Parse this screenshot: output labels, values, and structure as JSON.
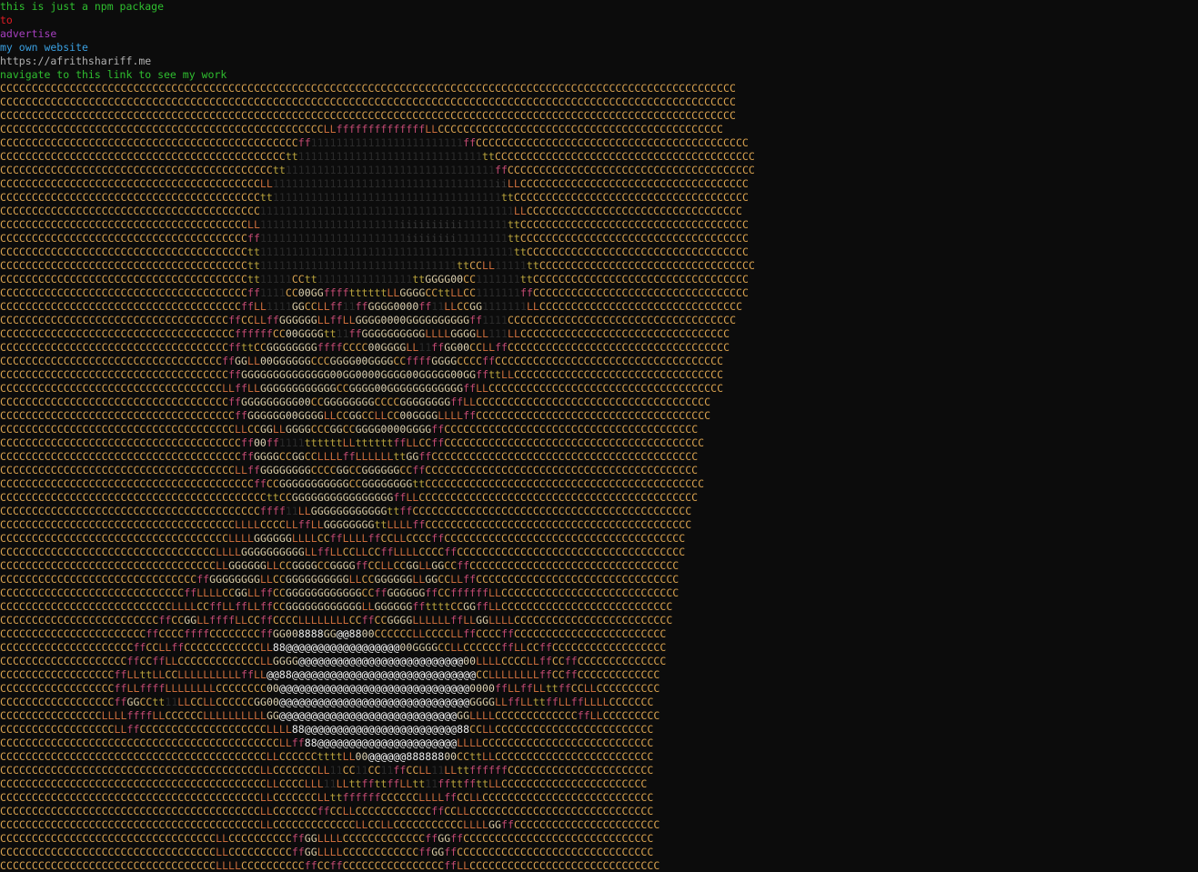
{
  "messages": [
    {
      "text": "this is just a npm package",
      "color": "#2fbf2f"
    },
    {
      "text": "to",
      "color": "#e01b24"
    },
    {
      "text": "advertise",
      "color": "#a63fbf"
    },
    {
      "text": "my own website",
      "color": "#3a9fe0"
    },
    {
      "text": "https://afrithshariff.me",
      "color": "#b0b0b0"
    },
    {
      "text": "navigate to this link to see my work",
      "color": "#2fbf2f"
    }
  ],
  "ascii_art": {
    "background_char": "C",
    "rows": [
      "CCCCCCCCCCCCCCCCCCCCCCCCCCCCCCCCCCCCCCCCCCCCCCCCCCCCCCCCCCCCCCCCCCCCCCCCCCCCCCCCCCCCCCCCCCCCCCCCCCCCCCCCCCCCCCCCCCCC",
      "CCCCCCCCCCCCCCCCCCCCCCCCCCCCCCCCCCCCCCCCCCCCCCCCCCCCCCCCCCCCCCCCCCCCCCCCCCCCCCCCCCCCCCCCCCCCCCCCCCCCCCCCCCCCCCCCCCCC",
      "CCCCCCCCCCCCCCCCCCCCCCCCCCCCCCCCCCCCCCCCCCCCCCCCCCCCCCCCCCCCCCCCCCCCCCCCCCCCCCCCCCCCCCCCCCCCCCCCCCCCCCCCCCCCCCCCCCCC",
      "CCCCCCCCCCCCCCCCCCCCCCCCCCCCCCCCCCCCCCCCCCCCCCCCCCCLLffffffffffffffLLCCCCCCCCCCCCCCCCCCCCCCCCCCCCCCCCCCCCCCCCCCCCC",
      "CCCCCCCCCCCCCCCCCCCCCCCCCCCCCCCCCCCCCCCCCCCCCCCff111111111111111111111111ffCCCCCCCCCCCCCCCCCCCCCCCCCCCCCCCCCCCCCCCCCCC",
      "CCCCCCCCCCCCCCCCCCCCCCCCCCCCCCCCCCCCCCCCCCCCCtt11111111111111111111111111111ttCCCCCCCCCCCCCCCCCCCCCCCCCCCCCCCCCCCCCCCCC",
      "CCCCCCCCCCCCCCCCCCCCCCCCCCCCCCCCCCCCCCCCCCCtt111111111111111111111111111111111ffCCCCCCCCCCCCCCCCCCCCCCCCCCCCCCCCCCCCCCC",
      "CCCCCCCCCCCCCCCCCCCCCCCCCCCCCCCCCCCCCCCCCLL11111111111111111111111111111111111iiLLCCCCCCCCCCCCCCCCCCCCCCCCCCCCCCCCCCCC",
      "CCCCCCCCCCCCCCCCCCCCCCCCCCCCCCCCCCCCCCCCCtt111111111111111111111111111111111111ttCCCCCCCCCCCCCCCCCCCCCCCCCCCCCCCCCCCCC",
      "CCCCCCCCCCCCCCCCCCCCCCCCCCCCCCCCCCCCCCCCC1111111111111111111111111111111111111111LLCCCCCCCCCCCCCCCCCCCCCCCCCCCCCCCCCC",
      "CCCCCCCCCCCCCCCCCCCCCCCCCCCCCCCCCCCCCCCLL1111111111111111111111iiiiiiiiii1111111ttCCCCCCCCCCCCCCCCCCCCCCCCCCCCCCCCCCCC",
      "CCCCCCCCCCCCCCCCCCCCCCCCCCCCCCCCCCCCCCCff11111111111111111111111iiiiiiii11111111ttCCCCCCCCCCCCCCCCCCCCCCCCCCCCCCCCCCCC",
      "CCCCCCCCCCCCCCCCCCCCCCCCCCCCCCCCCCCCCCCtt1111111111111111111111111111111111111111ttCCCCCCCCCCCCCCCCCCCCCCCCCCCCCCCCCCC",
      "CCCCCCCCCCCCCCCCCCCCCCCCCCCCCCCCCCCCCCCtt1111111111111111111111111111111ttCCLL11111ttCCCCCCCCCCCCCCCCCCCCCCCCCCCCCCCCCC",
      "CCCCCCCCCCCCCCCCCCCCCCCCCCCCCCCCCCCCCCCtt11111CCtt111111111111111ttGGGG00CC1111111ttCCCCCCCCCCCCCCCCCCCCCCCCCCCCCCCCCC",
      "CCCCCCCCCCCCCCCCCCCCCCCCCCCCCCCCCCCCCCCff1111CC00GGffffttttttLLGGGGCCttLLCC1111111ffCCCCCCCCCCCCCCCCCCCCCCCCCCCCCCCCCC",
      "CCCCCCCCCCCCCCCCCCCCCCCCCCCCCCCCCCCCCCffLL1111GGCCLLff11ffGGGG0000ff11LLCCGG1111111LLCCCCCCCCCCCCCCCCCCCCCCCCCCCCCCCC",
      "CCCCCCCCCCCCCCCCCCCCCCCCCCCCCCCCCCCCffCCLLffGGGGGGLLffLLGGGG0000GGGGGGGGGGff1111CCCCCCCCCCCCCCCCCCCCCCCCCCCCCCCCCCCC",
      "CCCCCCCCCCCCCCCCCCCCCCCCCCCCCCCCCCCCCffffffCC00GGGGtt11ffGGGGGGGGGGLLLLGGGGLL111LLCCCCCCCCCCCCCCCCCCCCCCCCCCCCCCCCC",
      "CCCCCCCCCCCCCCCCCCCCCCCCCCCCCCCCCCCCffttCCGGGGGGGGffffCCCC00GGGGLL11ffGG00CCLLffCCCCCCCCCCCCCCCCCCCCCCCCCCCCCCCCCCC",
      "CCCCCCCCCCCCCCCCCCCCCCCCCCCCCCCCCCCffGGLL00GGGGGGCCCGGGG00GGGGCCffffGGGGCCCCffCCCCCCCCCCCCCCCCCCCCCCCCCCCCCCCCCCCC",
      "CCCCCCCCCCCCCCCCCCCCCCCCCCCCCCCCCCCCffGGGGGGGGGGGGGG00GG0000GGGG00GGGGG00GGffttLLCCCCCCCCCCCCCCCCCCCCCCCCCCCCCCCCC",
      "CCCCCCCCCCCCCCCCCCCCCCCCCCCCCCCCCCCLLffLLGGGGGGGGGGGGCCGGGG00GGGGGGGGGGGGffLLCCCCCCCCCCCCCCCCCCCCCCCCCCCCCCCCCCCCC",
      "CCCCCCCCCCCCCCCCCCCCCCCCCCCCCCCCCCCCffGGGGGGGGG00CCGGGGGGGGCCCCGGGGGGGGffLLCCCCCCCCCCCCCCCCCCCCCCCCCCCCCCCCCCCCC",
      "CCCCCCCCCCCCCCCCCCCCCCCCCCCCCCCCCCCCCffGGGGGG00GGGGLLCCGGCCLLCC00GGGGLLLLffCCCCCCCCCCCCCCCCCCCCCCCCCCCCCCCCCCCCC",
      "CCCCCCCCCCCCCCCCCCCCCCCCCCCCCCCCCCCCCLLCCGGLLGGGGCCCGGCCGGGG0000GGGGffCCCCCCCCCCCCCCCCCCCCCCCCCCCCCCCCCCCCCCCC",
      "CCCCCCCCCCCCCCCCCCCCCCCCCCCCCCCCCCCCCCff00ff1111ttttttLLttttttffLLCCffCCCCCCCCCCCCCCCCCCCCCCCCCCCCCCCCCCCCCCCCC",
      "CCCCCCCCCCCCCCCCCCCCCCCCCCCCCCCCCCCCCCffGGGGCCGGCCLLLLffLLLLLLttGGffCCCCCCCCCCCCCCCCCCCCCCCCCCCCCCCCCCCCCCCCCC",
      "CCCCCCCCCCCCCCCCCCCCCCCCCCCCCCCCCCCCCLLffGGGGGGGGCCCCGGCCGGGGGGCCffCCCCCCCCCCCCCCCCCCCCCCCCCCCCCCCCCCCCCCCCCCC",
      "CCCCCCCCCCCCCCCCCCCCCCCCCCCCCCCCCCCCCCCCffCCGGGGGGGGGGGCCGGGGGGGGttCCCCCCCCCCCCCCCCCCCCCCCCCCCCCCCCCCCCCCCCCCCC",
      "CCCCCCCCCCCCCCCCCCCCCCCCCCCCCCCCCCCCCCCCCCttCCGGGGGGGGGGGGGGGGffLLCCCCCCCCCCCCCCCCCCCCCCCCCCCCCCCCCCCCCCCCCCCC",
      "CCCCCCCCCCCCCCCCCCCCCCCCCCCCCCCCCCCCCCCCCffff11LLGGGGGGGGGGGGttffCCCCCCCCCCCCCCCCCCCCCCCCCCCCCCCCCCCCCCCCCCCC",
      "CCCCCCCCCCCCCCCCCCCCCCCCCCCCCCCCCCCCCLLLLCCCCLLffLLGGGGGGGGttLLLLffCCCCCCCCCCCCCCCCCCCCCCCCCCCCCCCCCCCCCCCCCC",
      "CCCCCCCCCCCCCCCCCCCCCCCCCCCCCCCCCCCCLLLLGGGGGGLLLLCCffLLLLffCCLLCCCCffCCCCCCCCCCCCCCCCCCCCCCCCCCCCCCCCCCCCCC",
      "CCCCCCCCCCCCCCCCCCCCCCCCCCCCCCCCCCLLLLGGGGGGGGGGLLffLLCCLLCCffLLLLCCCCffCCCCCCCCCCCCCCCCCCCCCCCCCCCCCCCCCCCC",
      "CCCCCCCCCCCCCCCCCCCCCCCCCCCCCCCCCCLLGGGGGGLLCCGGGGCCGGGGffCCLLCCGGLLGGCCffCCCCCCCCCCCCCCCCCCCCCCCCCCCCCCCCC",
      "CCCCCCCCCCCCCCCCCCCCCCCCCCCCCCCffGGGGGGGGLLCCGGGGGGGGGGLLCCGGGGGGLLGGCCLLffCCCCCCCCCCCCCCCCCCCCCCCCCCCCCCCC",
      "CCCCCCCCCCCCCCCCCCCCCCCCCCCCCffLLLLCCGGLLffCCGGGGGGGGGGGGCCffGGGGGGffCCffffffLLCCCCCCCCCCCCCCCCCCCCCCCCCCCC",
      "CCCCCCCCCCCCCCCCCCCCCCCCCCCLLLLCCffLLffLLffCCGGGGGGGGGGGGLLGGGGGGffttttCCGGffLLCCCCCCCCCCCCCCCCCCCCCCCCCCC",
      "CCCCCCCCCCCCCCCCCCCCCCCCCffCCGGLLffffLLCCffCCCCLLLLLLLLCCffCCGGGGLLLLLLffLLGGLLLLCCCCCCCCCCCCCCCCCCCCCCCCC",
      "CCCCCCCCCCCCCCCCCCCCCCCffCCCCffffCCCCCCCCffGG008888GG@@8800CCCCCCLLCCCCLLffCCCCffCCCCCCCCCCCCCCCCCCCCCCCC",
      "CCCCCCCCCCCCCCCCCCCCCffCCLLffCCCCCCCCCCCCLL88@@@@@@@@@@@@@@@@@@00GGGGCCLLCCCCCCffLLCCffCCCCCCCCCCCCCCCCCC",
      "CCCCCCCCCCCCCCCCCCCCffCCffLLCCCCCCCCCCCCCLLGGGG@@@@@@@@@@@@@@@@@@@@@@@@@@00LLLLCCCCLLffCCffCCCCCCCCCCCCCC",
      "CCCCCCCCCCCCCCCCCCffLLttLLCCLLLLLLLLLLffLL@@88@@@@@@@@@@@@@@@@@@@@@@@@@@@@@CCLLLLLLLLffCCffCCCCCCCCCCCCC",
      "CCCCCCCCCCCCCCCCCCffLLffffLLLLLLLLCCCCCCCC00@@@@@@@@@@@@@@@@@@@@@@@@@@@@@@0000ffLLffLLttffCCLLCCCCCCCCCC",
      "CCCCCCCCCCCCCCCCCCffGGCCtt11LLCCLLCCCCCCGG00@@@@@@@@@@@@@@@@@@@@@@@@@@@@@@GGGGLLffLLttffLLffLLLLCCCCCCC",
      "CCCCCCCCCCCCCCCCLLLLffffLLCCCCCCLLLLLLLLLLGG@@@@@@@@@@@@@@@@@@@@@@@@@@@@GGLLLLCCCCCCCCCCCCCffLLCCCCCCCCC",
      "CCCCCCCCCCCCCCCCCCLLffCCCCCCCCCCCCCCCCCCCCLLLL88@@@@@@@@@@@@@@@@@@@@@@@@88CCLLCCCCCCCCCCCCCCCCCCCCCCCCC",
      "CCCCCCCCCCCCCCCCCCCCCCCCCCCCCCCCCCCCCCCCCCCCLLff88@@@@@@@@@@@@@@@@@@@@@@LLLLCCCCCCCCCCCCCCCCCCCCCCCCCCC",
      "CCCCCCCCCCCCCCCCCCCCCCCCCCCCCCCCCCCCCCCCCCLLCCCCCCttttLL00@@@@@@88888800CCttLLCCCCCCCCCCCCCCCCCCCCCCCCC",
      "CCCCCCCCCCCCCCCCCCCCCCCCCCCCCCCCCCCCCCCCCLLCCCCCCCLL11CC11CC11ffCCLL11LLttffffffCCCCCCCCCCCCCCCCCCCCCCC",
      "CCCCCCCCCCCCCCCCCCCCCCCCCCCCCCCCCCCCCCCCCCLLCCCCLLL11LLttffttffLLtt11ffttffttLLCCCCCCCCCCCCCCCCCCCCCCC",
      "CCCCCCCCCCCCCCCCCCCCCCCCCCCCCCCCCCCCCCCCCLLCCCCCCCLLttffffffCCCCCCLLLLffCCLLCCCCCCCCCCCCCCCCCCCCCCCCCCC",
      "CCCCCCCCCCCCCCCCCCCCCCCCCCCCCCCCCCCCCCCCCLLCCCCCCCffCCLLCCCCCCCCCCCCffCCLLCCCCCCCCCCCCCCCCCCCCCCCCCCCCC",
      "CCCCCCCCCCCCCCCCCCCCCCCCCCCCCCCCCCCCCCCCCLLCCCCCCCCCCCCCLLCCLLCCCCCCCCCCCLLLLGGffCCCCCCCCCCCCCCCCCCCCCCC",
      "CCCCCCCCCCCCCCCCCCCCCCCCCCCCCCCCCCLLCCCCCCCCCCffGGLLLLCCCCCCCCCCCCCffGGffCCCCCCCCCCCCCCCCCCCCCCCCCCCCCC",
      "CCCCCCCCCCCCCCCCCCCCCCCCCCCCCCCCCCLLCCCCCCCCCCffGGLLLLCCCCCCCCCCCCffGGffCCCCCCCCCCCCCCCCCCCCCCCCCCCCCCC",
      "CCCCCCCCCCCCCCCCCCCCCCCCCCCCCCCCCCLLLLCCCCCCCCCCffCCffCCCCCCCCCCCCCCCCffLLCCCCCCCCCCCCCCCCCCCCCCCCCCCCCC"
    ]
  }
}
